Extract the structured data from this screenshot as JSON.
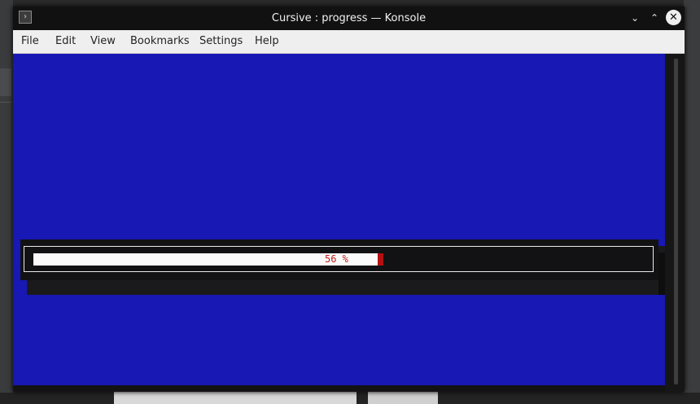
{
  "window": {
    "title": "Cursive : progress — Konsole",
    "icons": {
      "app": "terminal-icon",
      "minimize": "chevron-down-icon",
      "maximize": "chevron-up-icon",
      "close": "close-icon"
    }
  },
  "menubar": {
    "items": [
      "File",
      "Edit",
      "View",
      "Bookmarks",
      "Settings",
      "Help"
    ]
  },
  "progress": {
    "label": "56 %",
    "value": 56
  },
  "colors": {
    "terminal_background": "#1818b4",
    "progress_text": "#c01c1c",
    "progress_fill": "#fbfbfb",
    "dialog_background": "#121214"
  }
}
